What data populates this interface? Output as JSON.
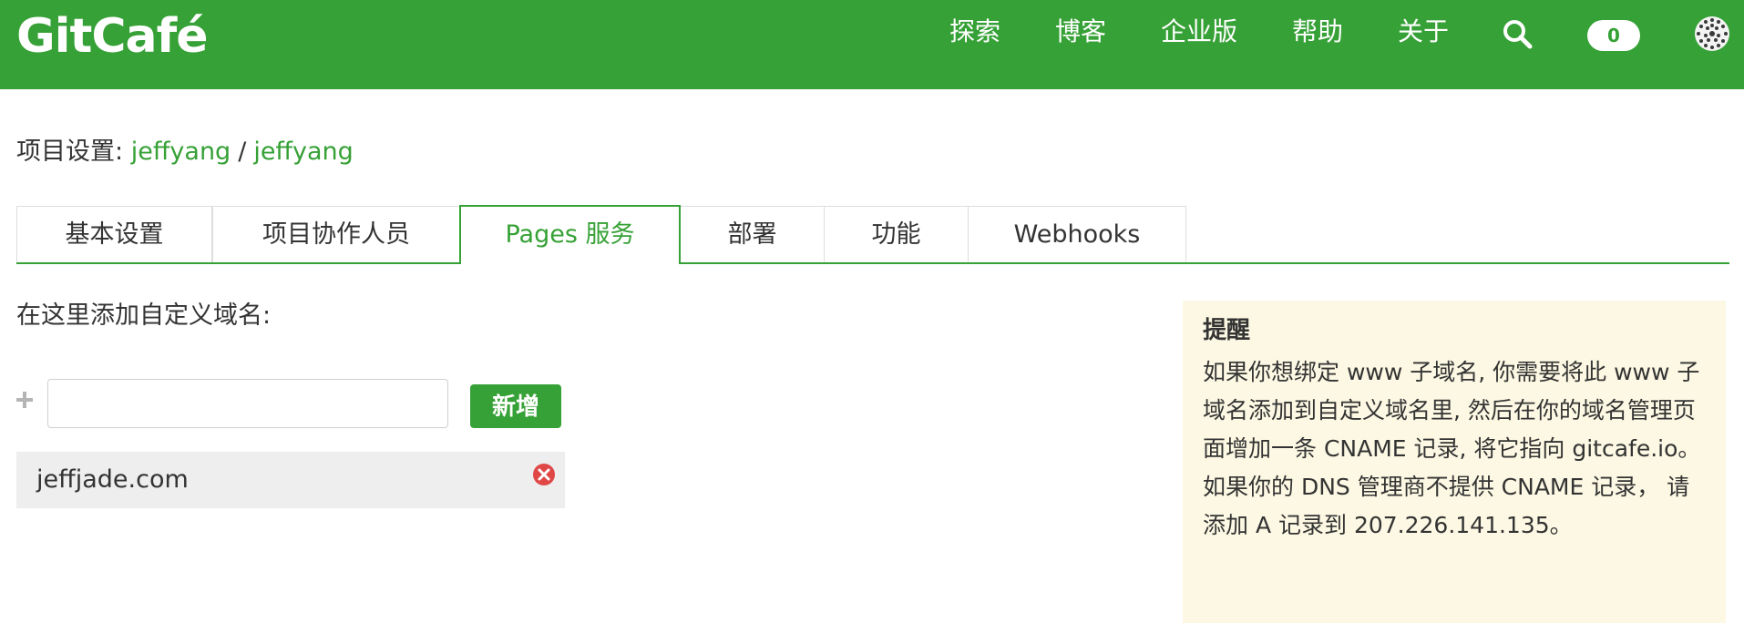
{
  "header": {
    "logo": "GitCafé",
    "nav": [
      "探索",
      "博客",
      "企业版",
      "帮助",
      "关于"
    ],
    "notification_count": "0"
  },
  "breadcrumb": {
    "prefix": "项目设置:",
    "owner": "jeffyang",
    "separator": "/",
    "repo": "jeffyang"
  },
  "tabs": [
    {
      "label": "基本设置"
    },
    {
      "label": "项目协作人员"
    },
    {
      "label": "Pages 服务",
      "active": true
    },
    {
      "label": "部署"
    },
    {
      "label": "功能"
    },
    {
      "label": "Webhooks"
    }
  ],
  "domains": {
    "section_label": "在这里添加自定义域名:",
    "input_value": "",
    "add_label": "新增",
    "items": [
      "jeffjade.com"
    ]
  },
  "reminder": {
    "title": "提醒",
    "body": "如果你想绑定 www 子域名, 你需要将此 www 子域名添加到自定义域名里, 然后在你的域名管理页面增加一条 CNAME 记录, 将它指向 gitcafe.io。如果你的 DNS 管理商不提供 CNAME 记录， 请添加 A 记录到 207.226.141.135。"
  },
  "colors": {
    "brand_green": "#36a136",
    "note_background": "#fcf8e3",
    "remove_red": "#e04848"
  }
}
